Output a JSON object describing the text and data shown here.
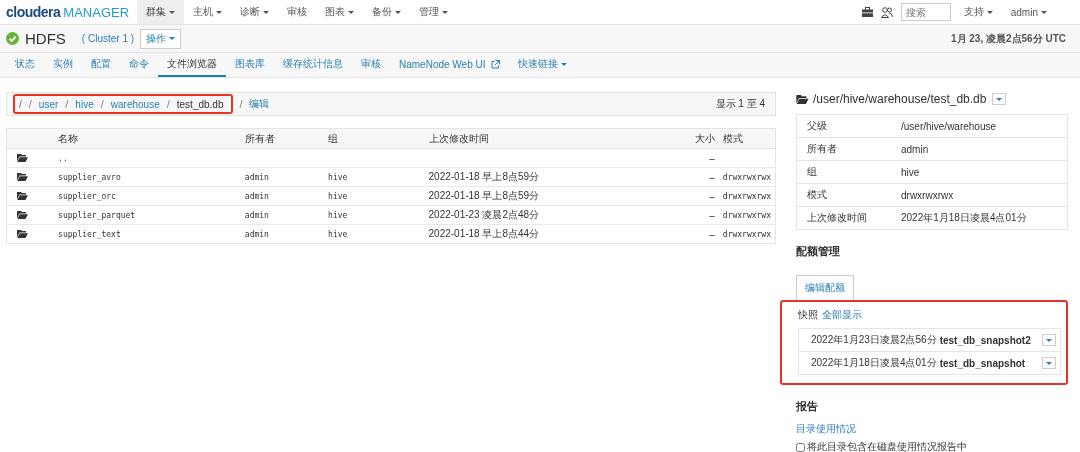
{
  "logo": {
    "brand": "cloudera",
    "product": "MANAGER"
  },
  "top_nav": [
    {
      "label": "群集",
      "dropdown": true,
      "selected": true
    },
    {
      "label": "主机",
      "dropdown": true,
      "selected": false
    },
    {
      "label": "诊断",
      "dropdown": true,
      "selected": false
    },
    {
      "label": "审核",
      "dropdown": false,
      "selected": false
    },
    {
      "label": "图表",
      "dropdown": true,
      "selected": false
    },
    {
      "label": "备份",
      "dropdown": true,
      "selected": false
    },
    {
      "label": "管理",
      "dropdown": true,
      "selected": false
    }
  ],
  "top_right": {
    "search": {
      "placeholder": "搜索"
    },
    "menus": [
      {
        "label": "支持"
      },
      {
        "label": "admin"
      }
    ]
  },
  "service": {
    "healthy": true,
    "name": "HDFS",
    "cluster": "( Cluster 1 )",
    "actions_button": "操作",
    "timestamp": "1月 23, 凌晨2点56分 UTC"
  },
  "tabs": [
    {
      "label": "状态",
      "kind": "plain",
      "selected": false
    },
    {
      "label": "实例",
      "kind": "plain",
      "selected": false
    },
    {
      "label": "配置",
      "kind": "plain",
      "selected": false
    },
    {
      "label": "命令",
      "kind": "plain",
      "selected": false
    },
    {
      "label": "文件浏览器",
      "kind": "plain",
      "selected": true
    },
    {
      "label": "图表库",
      "kind": "plain",
      "selected": false
    },
    {
      "label": "缓存统计信息",
      "kind": "plain",
      "selected": false
    },
    {
      "label": "审核",
      "kind": "plain",
      "selected": false
    },
    {
      "label": "NameNode Web UI",
      "kind": "external",
      "selected": false
    },
    {
      "label": "快速链接",
      "kind": "dropdown",
      "selected": false
    }
  ],
  "breadcrumb": {
    "highlighted": true,
    "separator": "/",
    "segments": [
      {
        "label": "/",
        "link": true
      },
      {
        "label": "user",
        "link": true
      },
      {
        "label": "hive",
        "link": true
      },
      {
        "label": "warehouse",
        "link": true
      },
      {
        "label": "test_db.db",
        "link": false
      }
    ],
    "edit_link": "编辑"
  },
  "pagination_text": "显示 1 至 4",
  "table": {
    "columns": [
      "名称",
      "所有者",
      "组",
      "上次修改时间",
      "大小",
      "模式"
    ],
    "rows": [
      {
        "name": "..",
        "size": "–"
      },
      {
        "name": "supplier_avro",
        "owner": "admin",
        "group": "hive",
        "modified": "2022-01-18 早上8点59分",
        "size": "–",
        "mode": "drwxrwxrwx"
      },
      {
        "name": "supplier_orc",
        "owner": "admin",
        "group": "hive",
        "modified": "2022-01-18 早上8点59分",
        "size": "–",
        "mode": "drwxrwxrwx"
      },
      {
        "name": "supplier_parquet",
        "owner": "admin",
        "group": "hive",
        "modified": "2022-01-23 凌晨2点48分",
        "size": "–",
        "mode": "drwxrwxrwx"
      },
      {
        "name": "supplier_text",
        "owner": "admin",
        "group": "hive",
        "modified": "2022-01-18 早上8点44分",
        "size": "–",
        "mode": "drwxrwxrwx"
      }
    ]
  },
  "details": {
    "title": "/user/hive/warehouse/test_db.db",
    "properties": [
      {
        "label": "父级",
        "value": "/user/hive/warehouse"
      },
      {
        "label": "所有者",
        "value": "admin"
      },
      {
        "label": "组",
        "value": "hive"
      },
      {
        "label": "模式",
        "value": "drwxrwxrwx"
      },
      {
        "label": "上次修改时间",
        "value": "2022年1月18日凌晨4点01分"
      }
    ]
  },
  "quota": {
    "heading": "配额管理",
    "button": "编辑配额"
  },
  "snapshots": {
    "label": "快照",
    "show_all": "全部显示",
    "highlighted": true,
    "items": [
      {
        "time": "2022年1月23日凌晨2点56分",
        "name": "test_db_snapshot2"
      },
      {
        "time": "2022年1月18日凌晨4点01分",
        "name": "test_db_snapshot"
      }
    ]
  },
  "report": {
    "heading": "报告",
    "link": "目录使用情况",
    "checkbox": {
      "label": "将此目录包含在磁盘使用情况报告中",
      "checked": false
    }
  }
}
